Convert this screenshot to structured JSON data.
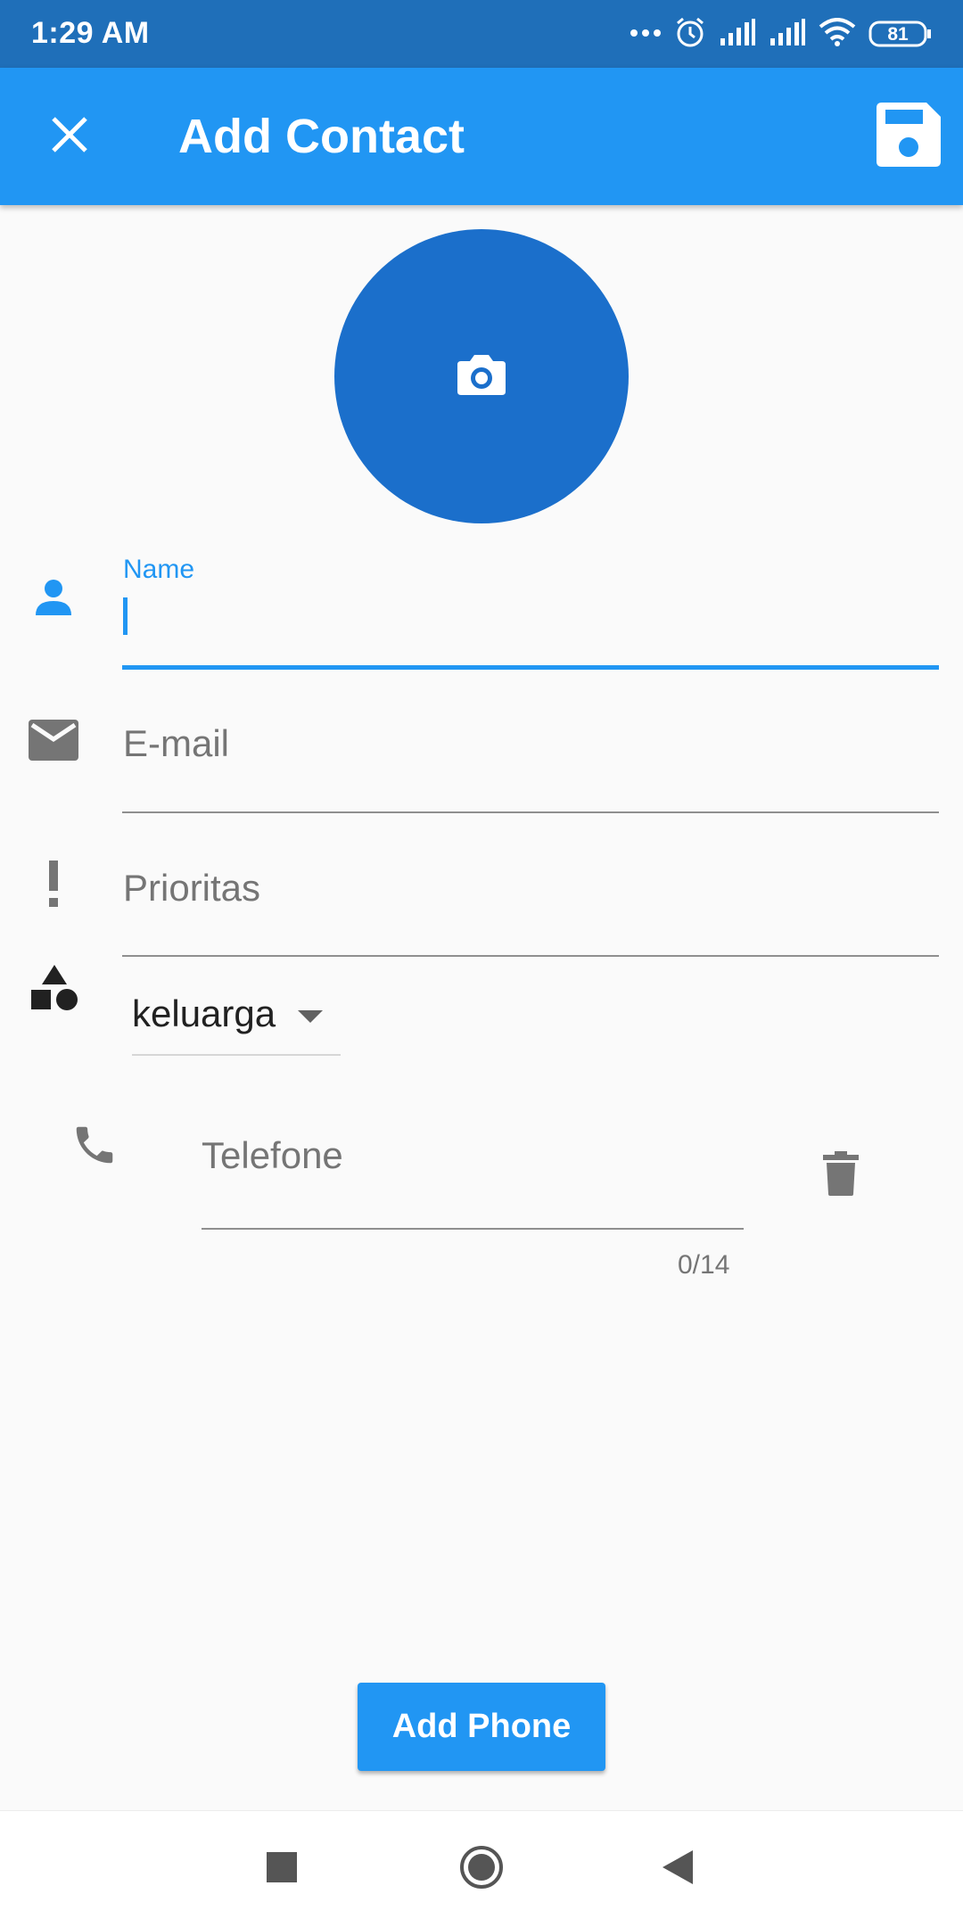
{
  "status_bar": {
    "time": "1:29 AM",
    "battery": "81",
    "icons": [
      "more-dots-icon",
      "alarm-icon",
      "signal-icon",
      "signal-icon",
      "wifi-icon",
      "battery-icon"
    ]
  },
  "app_bar": {
    "title": "Add Contact",
    "close_icon": "close-icon",
    "save_icon": "save-icon"
  },
  "avatar": {
    "icon": "camera-icon",
    "color": "#1b6fcb"
  },
  "form": {
    "name": {
      "label": "Name",
      "value": "",
      "icon": "person-icon"
    },
    "email": {
      "placeholder": "E-mail",
      "icon": "mail-icon"
    },
    "priority": {
      "placeholder": "Prioritas",
      "icon": "exclamation-icon"
    },
    "category": {
      "selected": "keluarga",
      "icon": "category-shapes-icon"
    },
    "phone": {
      "placeholder": "Telefone",
      "counter": "0/14",
      "icon": "phone-icon",
      "delete_icon": "trash-icon"
    }
  },
  "add_phone_button": {
    "label": "Add Phone"
  },
  "colors": {
    "primary": "#2196f3",
    "status_bar": "#1f6fb9",
    "background": "#fafafa"
  },
  "nav_bar": {
    "buttons": [
      "recent-apps-icon",
      "home-icon",
      "back-icon"
    ]
  }
}
